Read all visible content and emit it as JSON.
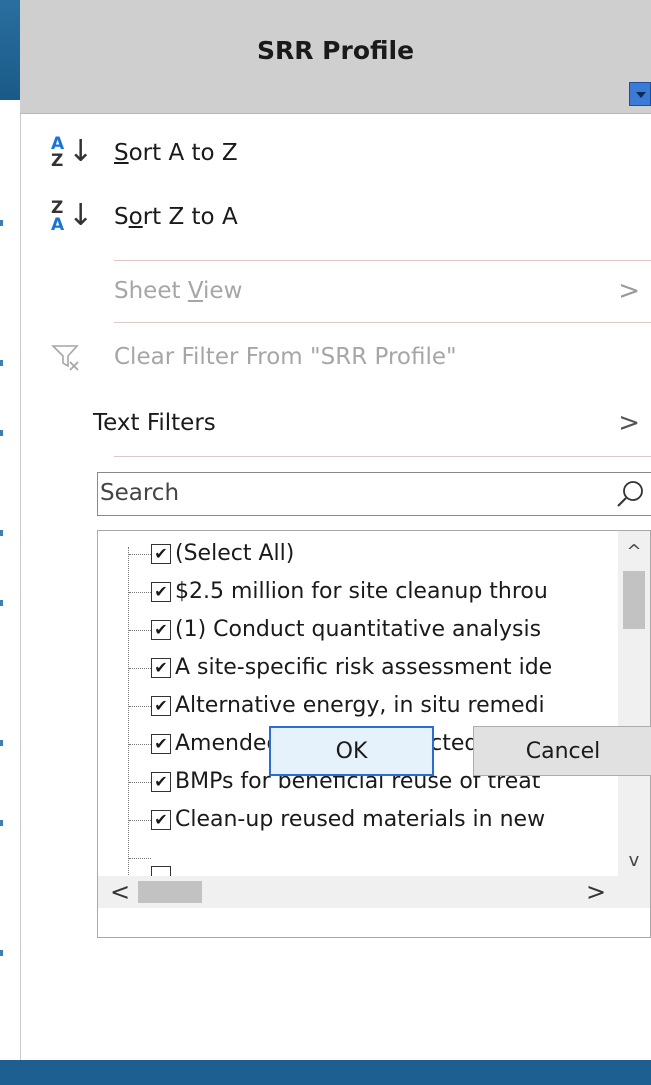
{
  "column_header": {
    "title": "SRR Profile",
    "dropdown_icon": "dropdown-arrow-icon"
  },
  "menu": {
    "sort_asc": {
      "label": "Sort A to Z",
      "mnemonic_index": 0,
      "icon": "sort-a-to-z-icon"
    },
    "sort_desc": {
      "label": "Sort Z to A",
      "mnemonic_index": 1,
      "icon": "sort-z-to-a-icon"
    },
    "sheet_view": {
      "label": "Sheet View",
      "mnemonic_index": 6,
      "enabled": false,
      "submenu_glyph": ">"
    },
    "clear_filter": {
      "label": "Clear Filter From \"SRR Profile\"",
      "enabled": false,
      "icon": "clear-filter-icon"
    },
    "text_filters": {
      "label": "Text Filters",
      "submenu_glyph": ">"
    }
  },
  "search": {
    "placeholder": "Search",
    "value": "",
    "icon": "magnifier-icon"
  },
  "filter_list": {
    "items": [
      {
        "label": "(Select All)",
        "checked": true
      },
      {
        "label": "$2.5 million for site cleanup throu",
        "checked": true
      },
      {
        "label": "(1) Conduct quantitative analysis",
        "checked": true
      },
      {
        "label": "A site-specific risk assessment ide",
        "checked": true
      },
      {
        "label": "Alternative energy, in situ remedi",
        "checked": true
      },
      {
        "label": "Amended tailings-impacted soil v",
        "checked": true
      },
      {
        "label": "BMPs for beneficial reuse of treat",
        "checked": true
      },
      {
        "label": "Clean-up reused materials in new",
        "checked": true
      }
    ],
    "check_glyph": "✔"
  },
  "buttons": {
    "ok": "OK",
    "cancel": "Cancel"
  },
  "colors": {
    "accent": "#2a6ed1",
    "header_bg": "#cfcfcf",
    "disabled_text": "#a6a6a6",
    "sort_blue": "#1a74d4"
  }
}
